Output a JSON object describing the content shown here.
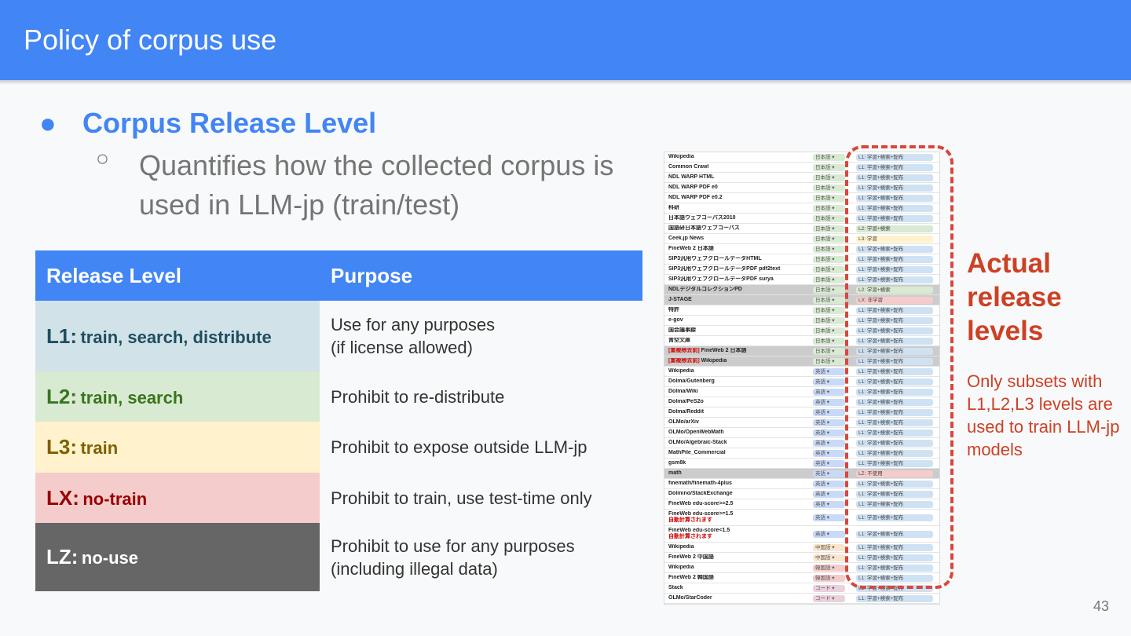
{
  "header": {
    "title": "Policy of corpus use"
  },
  "bullets": {
    "level1": "Corpus Release Level",
    "level2": "Quantifies how the collected corpus is used in LLM-jp (train/test)"
  },
  "table": {
    "headers": [
      "Release Level",
      "Purpose"
    ],
    "rows": [
      {
        "code": "L1:",
        "desc": "train, search, distribute",
        "purpose_lines": [
          "Use for any purposes",
          "(if license allowed)"
        ]
      },
      {
        "code": "L2:",
        "desc": "train, search",
        "purpose_lines": [
          "Prohibit to re-distribute"
        ]
      },
      {
        "code": "L3:",
        "desc": "train",
        "purpose_lines": [
          "Prohibit to expose outside LLM-jp"
        ]
      },
      {
        "code": "LX:",
        "desc": "no-train",
        "purpose_lines": [
          "Prohibit to train, use test-time only"
        ]
      },
      {
        "code": "LZ:",
        "desc": "no-use",
        "purpose_lines": [
          "Prohibit to use for any purposes",
          "(including illegal data)"
        ]
      }
    ]
  },
  "spreadsheet": {
    "colors": {
      "ja": "#d9ead3",
      "en": "#c9daf8",
      "zh": "#fce5cd",
      "ko": "#f4cccc",
      "code": "#ead1dc",
      "L1": "#cfe2f3",
      "L2": "#d9ead3",
      "L3": "#fff2cc",
      "LX": "#f4cccc",
      "LZ": "#f4cccc"
    },
    "rows": [
      {
        "name": "Wikipedia",
        "lang": "日本語",
        "lc": "ja",
        "rel": "L1: 学習+検索+配布",
        "rc": "L1"
      },
      {
        "name": "Common Crawl",
        "lang": "日本語",
        "lc": "ja",
        "rel": "L1: 学習+検索+配布",
        "rc": "L1"
      },
      {
        "name": "NDL WARP HTML",
        "lang": "日本語",
        "lc": "ja",
        "rel": "L1: 学習+検索+配布",
        "rc": "L1"
      },
      {
        "name": "NDL WARP PDF e0",
        "lang": "日本語",
        "lc": "ja",
        "rel": "L1: 学習+検索+配布",
        "rc": "L1"
      },
      {
        "name": "NDL WARP PDF e0.2",
        "lang": "日本語",
        "lc": "ja",
        "rel": "L1: 学習+検索+配布",
        "rc": "L1"
      },
      {
        "name": "科研",
        "lang": "日本語",
        "lc": "ja",
        "rel": "L1: 学習+検索+配布",
        "rc": "L1"
      },
      {
        "name": "日本語ウェブコーパス2010",
        "lang": "日本語",
        "lc": "ja",
        "rel": "L1: 学習+検索+配布",
        "rc": "L1"
      },
      {
        "name": "国語研日本語ウェブコーパス",
        "lang": "日本語",
        "lc": "ja",
        "rel": "L2: 学習+検索",
        "rc": "L2"
      },
      {
        "name": "Ceek.jp News",
        "lang": "日本語",
        "lc": "ja",
        "rel": "L3: 学習",
        "rc": "L3"
      },
      {
        "name": "FineWeb 2 日本語",
        "lang": "日本語",
        "lc": "ja",
        "rel": "L1: 学習+検索+配布",
        "rc": "L1"
      },
      {
        "name": "SIP3汎用ウェブクロールデータHTML",
        "lang": "日本語",
        "lc": "ja",
        "rel": "L1: 学習+検索+配布",
        "rc": "L1"
      },
      {
        "name": "SIP3汎用ウェブクロールデータPDF pdf2text",
        "lang": "日本語",
        "lc": "ja",
        "rel": "L1: 学習+検索+配布",
        "rc": "L1"
      },
      {
        "name": "SIP3汎用ウェブクロールデータPDF surya",
        "lang": "日本語",
        "lc": "ja",
        "rel": "L1: 学習+検索+配布",
        "rc": "L1"
      },
      {
        "name": "NDLデジタルコレクションPD",
        "lang": "日本語",
        "lc": "ja",
        "rel": "L2: 学習+検索",
        "rc": "L2",
        "grey": true
      },
      {
        "name": "J-STAGE",
        "lang": "日本語",
        "lc": "ja",
        "rel": "LX: 非学習",
        "rc": "LX",
        "grey": true
      },
      {
        "name": "特許",
        "lang": "日本語",
        "lc": "ja",
        "rel": "L1: 学習+検索+配布",
        "rc": "L1"
      },
      {
        "name": "e-gov",
        "lang": "日本語",
        "lc": "ja",
        "rel": "L1: 学習+検索+配布",
        "rc": "L1"
      },
      {
        "name": "国会議事録",
        "lang": "日本語",
        "lc": "ja",
        "rel": "L1: 学習+検索+配布",
        "rc": "L1"
      },
      {
        "name": "青空文庫",
        "lang": "日本語",
        "lc": "ja",
        "rel": "L1: 学習+検索+配布",
        "rc": "L1"
      },
      {
        "name": "FineWeb 2 日本語",
        "tag": "[重複除去前]",
        "lang": "日本語",
        "lc": "ja",
        "rel": "L1: 学習+検索+配布",
        "rc": "L1",
        "grey": true
      },
      {
        "name": "Wikipedia",
        "tag": "[重複除去前]",
        "lang": "日本語",
        "lc": "ja",
        "rel": "L1: 学習+検索+配布",
        "rc": "L1",
        "grey": true
      },
      {
        "name": "Wikipedia",
        "lang": "英語",
        "lc": "en",
        "rel": "L1: 学習+検索+配布",
        "rc": "L1"
      },
      {
        "name": "Dolma/Gutenberg",
        "lang": "英語",
        "lc": "en",
        "rel": "L1: 学習+検索+配布",
        "rc": "L1"
      },
      {
        "name": "Dolma/Wiki",
        "lang": "英語",
        "lc": "en",
        "rel": "L1: 学習+検索+配布",
        "rc": "L1"
      },
      {
        "name": "Dolma/PeS2o",
        "lang": "英語",
        "lc": "en",
        "rel": "L1: 学習+検索+配布",
        "rc": "L1"
      },
      {
        "name": "Dolma/Reddit",
        "lang": "英語",
        "lc": "en",
        "rel": "L1: 学習+検索+配布",
        "rc": "L1"
      },
      {
        "name": "OLMo/arXiv",
        "lang": "英語",
        "lc": "en",
        "rel": "L1: 学習+検索+配布",
        "rc": "L1"
      },
      {
        "name": "OLMo/OpenWebMath",
        "lang": "英語",
        "lc": "en",
        "rel": "L1: 学習+検索+配布",
        "rc": "L1"
      },
      {
        "name": "OLMo/Algebraic-Stack",
        "lang": "英語",
        "lc": "en",
        "rel": "L1: 学習+検索+配布",
        "rc": "L1"
      },
      {
        "name": "MathPile_Commercial",
        "lang": "英語",
        "lc": "en",
        "rel": "L1: 学習+検索+配布",
        "rc": "L1"
      },
      {
        "name": "gsm8k",
        "lang": "英語",
        "lc": "en",
        "rel": "L1: 学習+検索+配布",
        "rc": "L1"
      },
      {
        "name": "math",
        "lang": "英語",
        "lc": "en",
        "rel": "LZ: 不使用",
        "rc": "LZ",
        "grey": true
      },
      {
        "name": "finemath/finemath-4plus",
        "lang": "英語",
        "lc": "en",
        "rel": "L1: 学習+検索+配布",
        "rc": "L1"
      },
      {
        "name": "Dolmino/StackExchange",
        "lang": "英語",
        "lc": "en",
        "rel": "L1: 学習+検索+配布",
        "rc": "L1"
      },
      {
        "name": "FineWeb edu-score>=2.5",
        "lang": "英語",
        "lc": "en",
        "rel": "L1: 学習+検索+配布",
        "rc": "L1"
      },
      {
        "name": "FineWeb edu-score>=1.5",
        "note": "自動計算されます",
        "lang": "英語",
        "lc": "en",
        "rel": "L1: 学習+検索+配布",
        "rc": "L1"
      },
      {
        "name": "FineWeb edu-score<1.5",
        "note": "自動計算されます",
        "lang": "英語",
        "lc": "en",
        "rel": "L1: 学習+検索+配布",
        "rc": "L1"
      },
      {
        "name": "Wikipedia",
        "lang": "中国語",
        "lc": "zh",
        "rel": "L1: 学習+検索+配布",
        "rc": "L1"
      },
      {
        "name": "FineWeb 2 中国語",
        "lang": "中国語",
        "lc": "zh",
        "rel": "L1: 学習+検索+配布",
        "rc": "L1"
      },
      {
        "name": "Wikipedia",
        "lang": "韓国語",
        "lc": "ko",
        "rel": "L1: 学習+検索+配布",
        "rc": "L1"
      },
      {
        "name": "FineWeb 2 韓国語",
        "lang": "韓国語",
        "lc": "ko",
        "rel": "L1: 学習+検索+配布",
        "rc": "L1"
      },
      {
        "name": "Stack",
        "lang": "コード",
        "lc": "code",
        "rel": "L1: 学習+検索+配布",
        "rc": "L1"
      },
      {
        "name": "OLMo/StarCoder",
        "lang": "コード",
        "lc": "code",
        "rel": "L1: 学習+検索+配布",
        "rc": "L1"
      }
    ]
  },
  "callout": {
    "title_lines": [
      "Actual",
      "release",
      "levels"
    ],
    "note": "Only subsets with L1,L2,L3 levels are used to train LLM-jp models",
    "color": "#cc4125"
  },
  "page_number": "43"
}
